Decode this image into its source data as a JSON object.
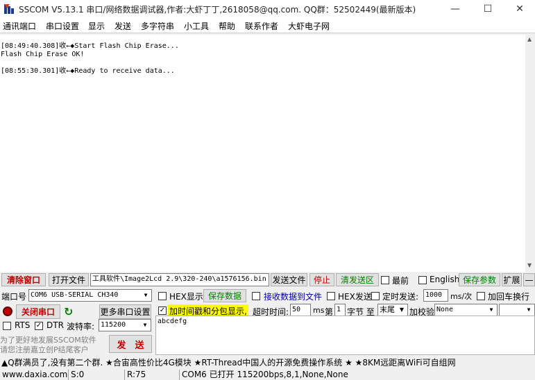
{
  "window": {
    "title": "SSCOM V5.13.1 串口/网络数据调试器,作者:大虾丁丁,2618058@qq.com. QQ群：52502449(最新版本)",
    "minimize_glyph": "—",
    "maximize_glyph": "☐",
    "close_glyph": "✕"
  },
  "menu": [
    "通讯端口",
    "串口设置",
    "显示",
    "发送",
    "多字符串",
    "小工具",
    "帮助",
    "联系作者",
    "大虾电子网"
  ],
  "output": {
    "lines": [
      "[08:49:40.308]收←◆Start Flash Chip Erase...",
      "Flash Chip Erase OK!",
      "",
      "[08:55:30.301]收←◆Ready to receive data..."
    ]
  },
  "toolbar1": {
    "clear_window": "清除窗口",
    "open_file": "打开文件",
    "file_path": "工具软件\\Image2Lcd 2.9\\320-240\\a1576156.bin",
    "send_file": "发送文件",
    "stop": "停止",
    "clear_send": "清发送区",
    "topmost": "最前",
    "english": "English",
    "save_params": "保存参数",
    "expand": "扩展",
    "collapse": "—"
  },
  "toolbar2": {
    "port_label": "端口号",
    "port_value": "COM6 USB-SERIAL CH340",
    "hex_display": "HEX显示",
    "save_data": "保存数据",
    "recv_to_file": "接收数据到文件",
    "hex_send": "HEX发送",
    "timed_send": "定时发送:",
    "interval": "1000",
    "interval_unit": "ms/次",
    "add_crlf": "加回车换行"
  },
  "toolbar3": {
    "close_port": "关闭串口",
    "more_settings": "更多串口设置",
    "timestamp": "加时间戳和分包显示,",
    "timeout_label": "超时时间:",
    "timeout_value": "50",
    "timeout_unit": "ms",
    "nth_label": "第",
    "nth_value": "1",
    "byte_label": "字节 至",
    "end_value": "末尾",
    "checksum_label": "加校验",
    "checksum_value": "None"
  },
  "toolbar4": {
    "rts": "RTS",
    "dtr": "DTR",
    "baud_label": "波特率:",
    "baud_value": "115200"
  },
  "promo": {
    "line1": "为了更好地发展SSCOM软件",
    "line2": "请您注册嘉立创P结尾客户",
    "send_button": "发　送"
  },
  "send_text": "abcdefg",
  "news": "▲Q群满员了,没有第二个群. ★合宙高性价比4G模块 ★RT-Thread中国人的开源免费操作系统 ★ ★8KM远距离WiFi可自组网",
  "status": {
    "site": "www.daxia.com",
    "sent": "S:0",
    "received": "R:75",
    "port_status": "COM6 已打开  115200bps,8,1,None,None"
  },
  "colors": {
    "red": "#c00000",
    "green": "#008000",
    "highlight": "#ffff00",
    "blue_text": "#0000a0"
  }
}
